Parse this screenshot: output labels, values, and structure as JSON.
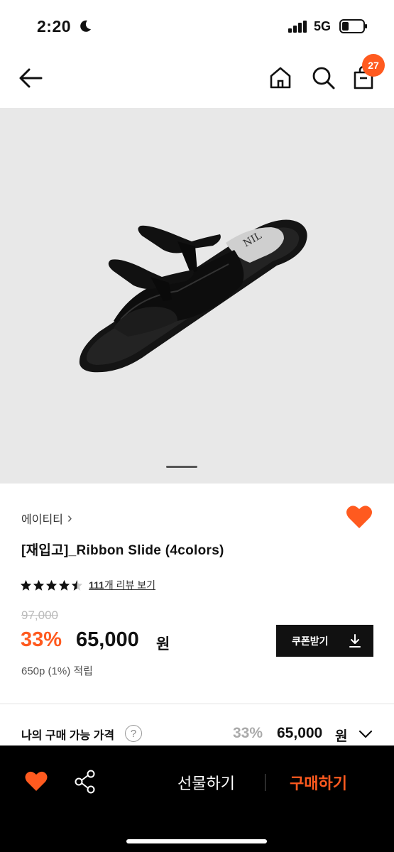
{
  "status_bar": {
    "time": "2:20",
    "network": "5G"
  },
  "nav": {
    "cart_count": "27"
  },
  "product": {
    "brand": "에이티티",
    "brand_chevron": "›",
    "title": "[재입고]_Ribbon Slide (4colors)",
    "rating": 4.5,
    "review_count": "111",
    "review_suffix": "개 리뷰 보기",
    "original_price": "97,000",
    "discount_rate": "33%",
    "sale_price": "65,000",
    "currency": "원",
    "points": "650p (1%) 적립",
    "coupon_label": "쿠폰받기",
    "image_pager": 1
  },
  "my_price": {
    "label": "나의 구매 가능 가격",
    "help": "?",
    "rate": "33%",
    "value": "65,000",
    "currency": "원"
  },
  "bottom_bar": {
    "gift_label": "선물하기",
    "buy_label": "구매하기"
  },
  "colors": {
    "accent": "#ff5a1f",
    "dark": "#111111",
    "image_bg": "#e8e8e8"
  }
}
